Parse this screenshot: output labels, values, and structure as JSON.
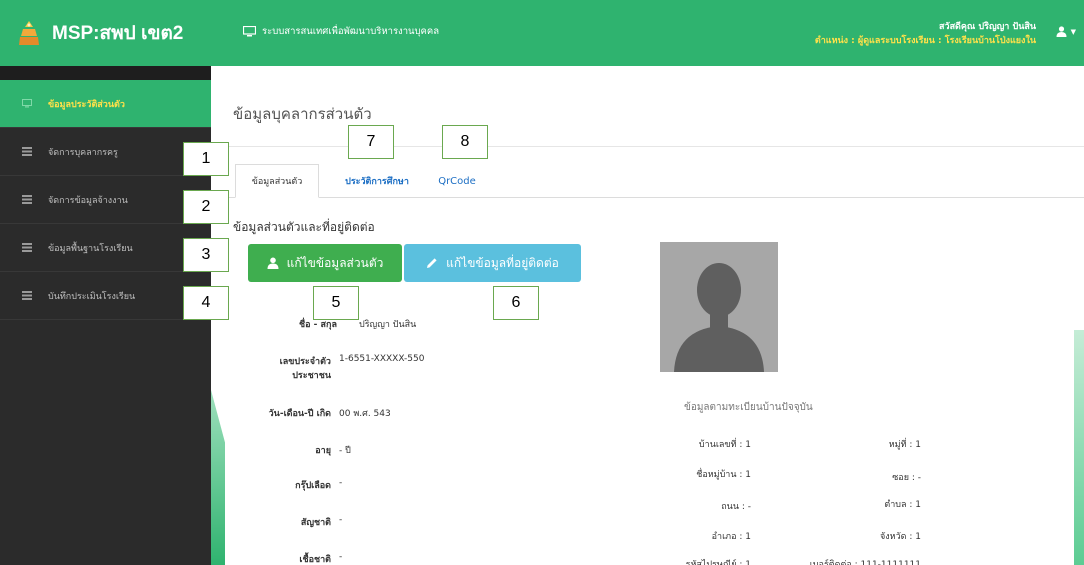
{
  "header": {
    "brand": "MSP:สพป เขต2",
    "system_title": "ระบบสารสนเทศเพื่อพัฒนาบริหารงานบุคคล",
    "greeting": "สวัสดีคุณ ปริญญา ปันสิน",
    "position": "ตำแหน่ง : ผู้ดูแลระบบโรงเรียน : โรงเรียนบ้านโป่งแยงใน",
    "user_caret": "▼"
  },
  "sidebar": {
    "items": [
      {
        "label": "ข้อมูลประวัติส่วนตัว"
      },
      {
        "label": "จัดการบุคลากรครู"
      },
      {
        "label": "จัดการข้อมูลจ้างงาน"
      },
      {
        "label": "ข้อมูลพื้นฐานโรงเรียน"
      },
      {
        "label": "บันทึกประเมินโรงเรียน"
      }
    ]
  },
  "main": {
    "page_title": "ข้อมูลบุคลากรส่วนตัว",
    "tabs": [
      {
        "label": "ข้อมูลส่วนตัว"
      },
      {
        "label": "ประวัติการศึกษา"
      },
      {
        "label": "QrCode"
      }
    ],
    "section_title": "ข้อมูลส่วนตัวและที่อยู่ติดต่อ",
    "edit_personal_label": "แก้ไขข้อมูลส่วนตัว",
    "edit_address_label": "แก้ไขข้อมูลที่อยู่ติดต่อ",
    "fields": [
      {
        "label": "ชื่อ - สกุล",
        "value": "ปริญญา ปันสิน"
      },
      {
        "label": "เลขประจำตัว",
        "label2": "ประชาชน",
        "value": "1-6551-XXXXX-550"
      },
      {
        "label": "วัน-เดือน-ปี เกิด",
        "value": "00 พ.ศ. 543"
      },
      {
        "label": "อายุ",
        "value": "- ปี"
      },
      {
        "label": "กรุ๊ปเลือด",
        "value": "-"
      },
      {
        "label": "สัญชาติ",
        "value": "-"
      },
      {
        "label": "เชื้อชาติ",
        "value": "-"
      }
    ],
    "address": {
      "heading": "ข้อมูลตามทะเบียนบ้านปัจจุบัน",
      "house_no": "บ้านเลขที่ : 1",
      "moo": "หมู่ที่ : 1",
      "village": "ชื่อหมู่บ้าน : 1",
      "soi": "ซอย : -",
      "road": "ถนน : -",
      "tambon": "ตำบล : 1",
      "amphoe": "อำเภอ : 1",
      "province": "จังหวัด : 1",
      "postcode": "รหัสไปรษณีย์ : 1",
      "phone": "เบอร์ติดต่อ : 111-1111111"
    }
  },
  "annotations": [
    "1",
    "2",
    "3",
    "4",
    "5",
    "6",
    "7",
    "8"
  ],
  "colors": {
    "brand_green": "#2fb36f",
    "sidebar_dark": "#2b2b2b",
    "highlight_yellow": "#ffe14a",
    "btn_success": "#3fae4f",
    "btn_info": "#5bc0de",
    "link_blue": "#1d6fc4"
  }
}
